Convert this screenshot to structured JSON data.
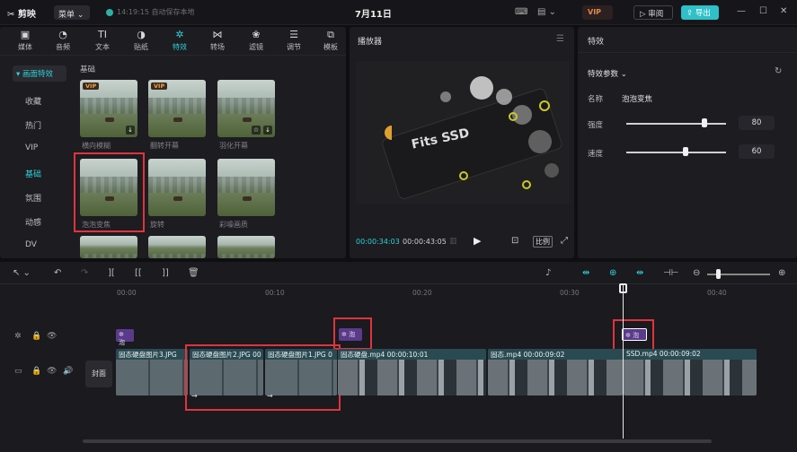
{
  "app": {
    "name": "剪映",
    "menu_label": "菜单",
    "saved_status": "14:19:15 自动保存本地",
    "project_title": "7月11日"
  },
  "header": {
    "vip_label": "VIP",
    "review_label": "审阅",
    "export_label": "导出"
  },
  "toolbar": {
    "tabs": [
      {
        "label": "媒体",
        "icon": "media-icon"
      },
      {
        "label": "音频",
        "icon": "audio-icon"
      },
      {
        "label": "文本",
        "icon": "text-icon"
      },
      {
        "label": "贴纸",
        "icon": "sticker-icon"
      },
      {
        "label": "特效",
        "icon": "effects-icon",
        "active": true
      },
      {
        "label": "转场",
        "icon": "transition-icon"
      },
      {
        "label": "滤镜",
        "icon": "filter-icon"
      },
      {
        "label": "调节",
        "icon": "adjust-icon"
      },
      {
        "label": "模板",
        "icon": "template-icon"
      }
    ]
  },
  "sidebar": {
    "top_item": "▾ 画面特效",
    "items": [
      "收藏",
      "热门",
      "VIP",
      "基础",
      "氛围",
      "动感",
      "DV"
    ],
    "selected": "基础"
  },
  "library": {
    "section_title": "基础",
    "effects": [
      {
        "label": "横向模糊",
        "vip": true,
        "download": true
      },
      {
        "label": "翻转开幕",
        "vip": true,
        "download": false
      },
      {
        "label": "羽化开幕",
        "vip": false,
        "download": true
      },
      {
        "label": "泡泡变焦",
        "vip": false,
        "download": false,
        "highlighted": true
      },
      {
        "label": "旋转",
        "vip": false,
        "download": false
      },
      {
        "label": "彩噪画质",
        "vip": false,
        "download": false
      }
    ]
  },
  "player": {
    "title": "播放器",
    "current_time": "00:00:34:03",
    "total_time": "00:00:43:05",
    "ratio_label": "比例",
    "screen_text": "Fits SSD"
  },
  "properties": {
    "title": "特效",
    "section": "特效参数",
    "name_label": "名称",
    "name_value": "泡泡变焦",
    "params": [
      {
        "label": "强度",
        "value": "80",
        "level": 0.8
      },
      {
        "label": "速度",
        "value": "60",
        "level": 0.6
      }
    ]
  },
  "timeline": {
    "ruler": [
      "00:00",
      "00:10",
      "00:20",
      "00:30",
      "00:40"
    ],
    "cover_label": "封面",
    "effect_clips": [
      "泡",
      "泡",
      "泡"
    ],
    "video_clips": [
      {
        "label": "固态硬盘图片3.JPG"
      },
      {
        "label": "固态硬盘图片2.JPG",
        "extra": "00"
      },
      {
        "label": "固态硬盘图片1.JPG",
        "extra": "0"
      },
      {
        "label": "固态硬盘.mp4",
        "duration": "00:00:10:01"
      },
      {
        "label": "固态.mp4",
        "duration": "00:00:09:02"
      },
      {
        "label": "SSD.mp4",
        "duration": "00:00:09:02"
      }
    ]
  }
}
